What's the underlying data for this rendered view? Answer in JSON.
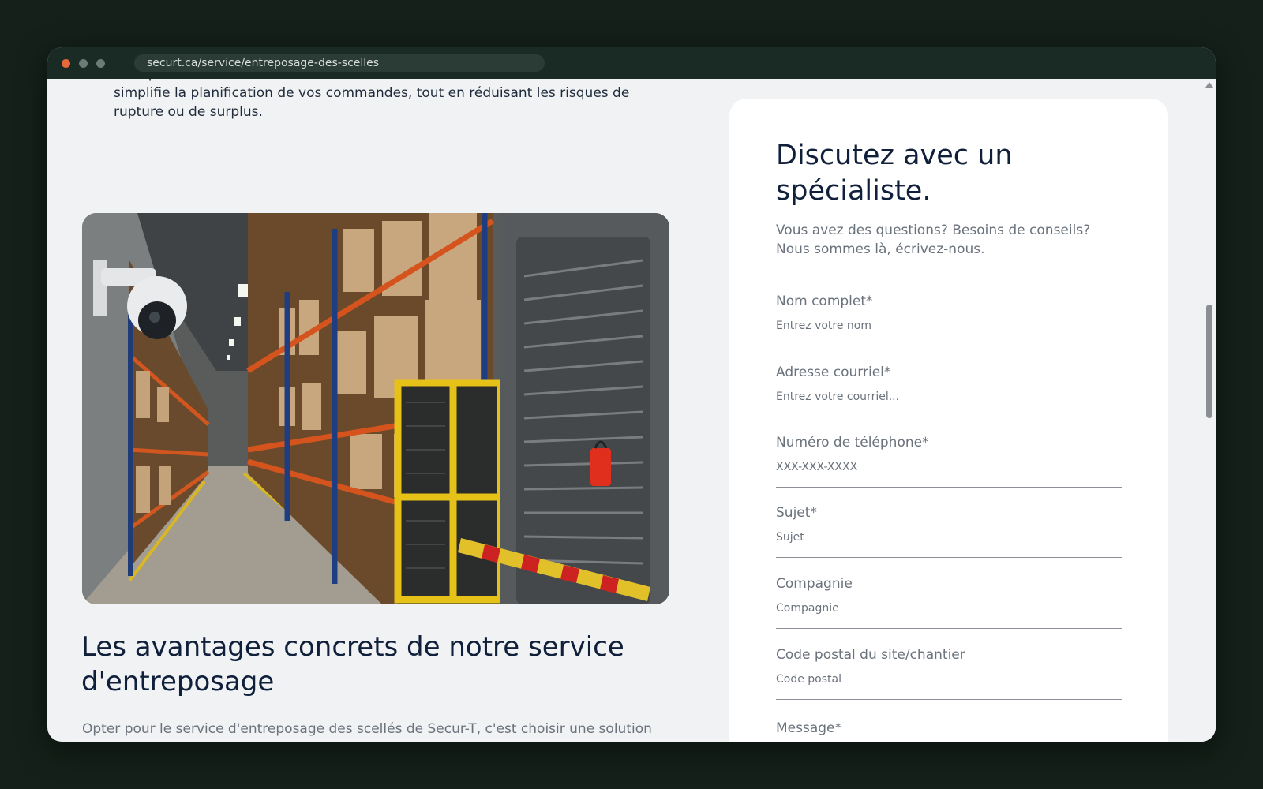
{
  "browser": {
    "url": "securt.ca/service/entreposage-des-scelles"
  },
  "main": {
    "intro_text": "transparence. Cela vous assure une visibilité constante sur vos stocks et simplifie la planification de vos commandes, tout en réduisant les risques de rupture ou de surplus.",
    "section_title": "Les avantages concrets de notre service d'entreposage",
    "section_text": "Opter pour le service d'entreposage des scellés de Secur-T, c'est choisir une solution"
  },
  "form": {
    "title": "Discutez avec un spécialiste.",
    "subtitle": "Vous avez des questions? Besoins de conseils? Nous sommes là, écrivez-nous.",
    "fields": [
      {
        "label": "Nom complet*",
        "placeholder": "Entrez votre nom"
      },
      {
        "label": "Adresse courriel*",
        "placeholder": "Entrez votre courriel..."
      },
      {
        "label": "Numéro de téléphone*",
        "placeholder": "XXX-XXX-XXXX"
      },
      {
        "label": "Sujet*",
        "placeholder": "Sujet"
      },
      {
        "label": "Compagnie",
        "placeholder": "Compagnie"
      },
      {
        "label": "Code postal du site/chantier",
        "placeholder": "Code postal"
      }
    ],
    "message_label": "Message*"
  },
  "colors": {
    "page_bg": "#142019",
    "content_bg": "#f0f2f4",
    "heading": "#10203a",
    "muted_text": "#6a727c",
    "close_dot": "#e8683a"
  }
}
